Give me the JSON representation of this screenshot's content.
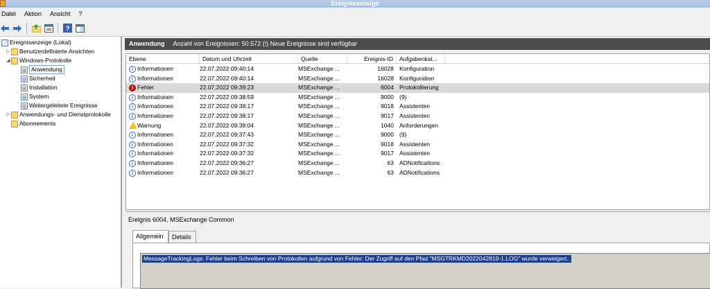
{
  "window": {
    "title": "Ereignisanzeige"
  },
  "menu": [
    "Datei",
    "Aktion",
    "Ansicht",
    "?"
  ],
  "tree": {
    "items": [
      {
        "label": "Ereignisanzeige (Lokal)",
        "indent": 0,
        "expander": "",
        "icon": "viewer"
      },
      {
        "label": "Benutzerdefinierte Ansichten",
        "indent": 1,
        "expander": "▷",
        "icon": "folder"
      },
      {
        "label": "Windows-Protokolle",
        "indent": 1,
        "expander": "◢",
        "icon": "folder"
      },
      {
        "label": "Anwendung",
        "indent": 2,
        "expander": "",
        "icon": "log",
        "selected": true
      },
      {
        "label": "Sicherheit",
        "indent": 2,
        "expander": "",
        "icon": "log"
      },
      {
        "label": "Installation",
        "indent": 2,
        "expander": "",
        "icon": "log"
      },
      {
        "label": "System",
        "indent": 2,
        "expander": "",
        "icon": "log"
      },
      {
        "label": "Weitergeleitete Ereignisse",
        "indent": 2,
        "expander": "",
        "icon": "log"
      },
      {
        "label": "Anwendungs- und Dienstprotokolle",
        "indent": 1,
        "expander": "▷",
        "icon": "folder"
      },
      {
        "label": "Abonnements",
        "indent": 1,
        "expander": "",
        "icon": "folder"
      }
    ]
  },
  "panel": {
    "title": "Anwendung",
    "summary": "Anzahl von Ereignissen: 50.572 (!) Neue Ereignisse sind verfügbar"
  },
  "grid": {
    "columns": [
      "Ebene",
      "Datum und Uhrzeit",
      "Quelle",
      "Ereignis-ID",
      "Aufgabenkat..."
    ],
    "rows": [
      {
        "level": "Informationen",
        "type": "info",
        "date": "22.07.2022 09:40:14",
        "source": "MSExchange ...",
        "id": "16028",
        "task": "Konfiguration"
      },
      {
        "level": "Informationen",
        "type": "info",
        "date": "22.07.2022 09:40:14",
        "source": "MSExchange ...",
        "id": "16028",
        "task": "Konfiguration"
      },
      {
        "level": "Fehler",
        "type": "error",
        "date": "22.07.2022 09:39:23",
        "source": "MSExchange ...",
        "id": "6004",
        "task": "Protokollierung",
        "selected": true
      },
      {
        "level": "Informationen",
        "type": "info",
        "date": "22.07.2022 09:38:59",
        "source": "MSExchange ...",
        "id": "9000",
        "task": "(9)"
      },
      {
        "level": "Informationen",
        "type": "info",
        "date": "22.07.2022 09:38:17",
        "source": "MSExchange ...",
        "id": "9018",
        "task": "Assistenten"
      },
      {
        "level": "Informationen",
        "type": "info",
        "date": "22.07.2022 09:38:17",
        "source": "MSExchange ...",
        "id": "9017",
        "task": "Assistenten"
      },
      {
        "level": "Warnung",
        "type": "warning",
        "date": "22.07.2022 09:38:04",
        "source": "MSExchange ...",
        "id": "1040",
        "task": "Anforderungen"
      },
      {
        "level": "Informationen",
        "type": "info",
        "date": "22.07.2022 09:37:43",
        "source": "MSExchange ...",
        "id": "9000",
        "task": "(9)"
      },
      {
        "level": "Informationen",
        "type": "info",
        "date": "22.07.2022 09:37:32",
        "source": "MSExchange ...",
        "id": "9018",
        "task": "Assistenten"
      },
      {
        "level": "Informationen",
        "type": "info",
        "date": "22.07.2022 09:37:32",
        "source": "MSExchange ...",
        "id": "9017",
        "task": "Assistenten"
      },
      {
        "level": "Informationen",
        "type": "info",
        "date": "22.07.2022 09:36:27",
        "source": "MSExchange ...",
        "id": "63",
        "task": "ADNotifications"
      },
      {
        "level": "Informationen",
        "type": "info",
        "date": "22.07.2022 09:36:27",
        "source": "MSExchange ...",
        "id": "63",
        "task": "ADNotifications"
      }
    ]
  },
  "details": {
    "title": "Ereignis 6004, MSExchange Common",
    "tabs": [
      "Allgemein",
      "Details"
    ],
    "message": "MessageTrackingLogs: Fehler beim Schreiben von Protokollen aufgrund von Fehler: Der Zugriff auf den Pfad \"MSGTRKMD2022042819-1.LOG\" wurde verweigert.."
  },
  "icons": {
    "back": "back-arrow-icon",
    "forward": "forward-arrow-icon",
    "up": "folder-up-icon",
    "properties": "properties-icon",
    "help": "help-icon",
    "pane": "show-pane-icon"
  },
  "colors": {
    "panel_header": "#4c4c4c",
    "selection": "#1c3f8c",
    "error": "#c4161c",
    "warning": "#f2c318",
    "info": "#3b63a8"
  }
}
